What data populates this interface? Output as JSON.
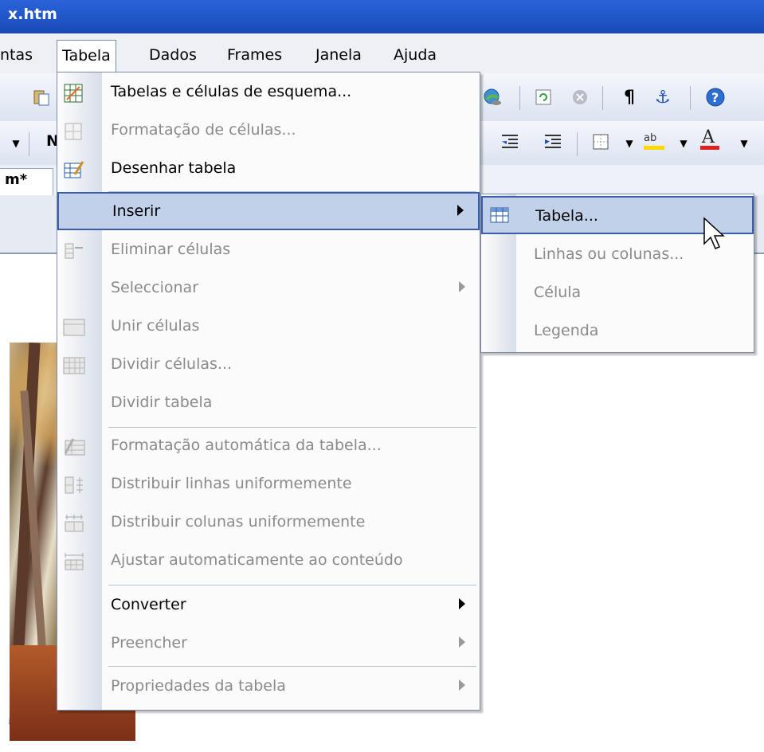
{
  "window": {
    "title": "x.htm"
  },
  "menubar": {
    "items": [
      {
        "label": "ntas"
      },
      {
        "label": "Tabela"
      },
      {
        "label": "Dados"
      },
      {
        "label": "Frames"
      },
      {
        "label": "Janela"
      },
      {
        "label": "Ajuda"
      }
    ]
  },
  "document_tab": {
    "label": "m*"
  },
  "toolbar": {
    "format_dropdown_fragment": "N",
    "icons": [
      "paste-icon",
      "globe-link-icon",
      "refresh-icon",
      "stop-icon",
      "paragraph-mark-icon",
      "anchor-icon",
      "help-icon",
      "decrease-indent-icon",
      "increase-indent-icon",
      "border-icon",
      "highlight-icon",
      "font-color-icon"
    ],
    "highlight_color": "#ffd800",
    "font_color": "#e02020"
  },
  "tabela_menu": {
    "items": [
      {
        "label": "Tabelas e células de esquema...",
        "enabled": true,
        "icon": "layout-table-icon"
      },
      {
        "label": "Formatação de células...",
        "enabled": false,
        "icon": "cell-format-icon"
      },
      {
        "label": "Desenhar tabela",
        "enabled": true,
        "icon": "draw-table-icon"
      },
      {
        "label": "Inserir",
        "enabled": true,
        "icon": "",
        "submenu": true,
        "selected": true
      },
      {
        "label": "Eliminar células",
        "enabled": false,
        "icon": "delete-cells-icon"
      },
      {
        "label": "Seleccionar",
        "enabled": false,
        "icon": "",
        "submenu": true
      },
      {
        "label": "Unir células",
        "enabled": false,
        "icon": "merge-cells-icon"
      },
      {
        "label": "Dividir células...",
        "enabled": false,
        "icon": "split-cells-icon"
      },
      {
        "label": "Dividir tabela",
        "enabled": false,
        "icon": ""
      },
      {
        "label": "Formatação automática da tabela...",
        "enabled": false,
        "icon": "autoformat-icon"
      },
      {
        "label": "Distribuir linhas uniformemente",
        "enabled": false,
        "icon": "distribute-rows-icon"
      },
      {
        "label": "Distribuir colunas uniformemente",
        "enabled": false,
        "icon": "distribute-columns-icon"
      },
      {
        "label": "Ajustar automaticamente ao conteúdo",
        "enabled": false,
        "icon": "autofit-icon"
      },
      {
        "label": "Converter",
        "enabled": true,
        "icon": "",
        "submenu": true
      },
      {
        "label": "Preencher",
        "enabled": false,
        "icon": "",
        "submenu": true
      },
      {
        "label": "Propriedades da tabela",
        "enabled": false,
        "icon": "",
        "submenu": true
      }
    ]
  },
  "inserir_submenu": {
    "items": [
      {
        "label": "Tabela...",
        "enabled": true,
        "selected": true,
        "icon": "insert-table-icon"
      },
      {
        "label": "Linhas ou colunas...",
        "enabled": false
      },
      {
        "label": "Célula",
        "enabled": false
      },
      {
        "label": "Legenda",
        "enabled": false
      }
    ]
  }
}
